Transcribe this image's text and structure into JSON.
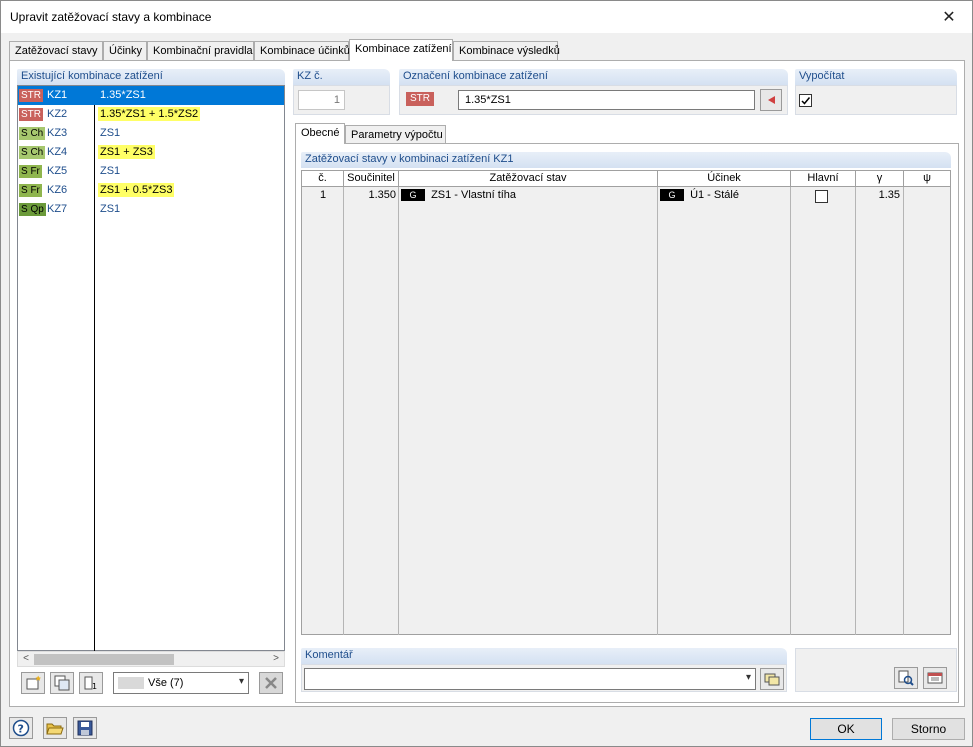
{
  "window": {
    "title": "Upravit zatěžovací stavy a kombinace"
  },
  "tabs": [
    {
      "label": "Zatěžovací stavy"
    },
    {
      "label": "Účinky"
    },
    {
      "label": "Kombinační pravidla"
    },
    {
      "label": "Kombinace účinků"
    },
    {
      "label": "Kombinace zatížení",
      "active": true
    },
    {
      "label": "Kombinace výsledků"
    }
  ],
  "left": {
    "header": "Existující kombinace zatížení",
    "rows": [
      {
        "badge": "STR",
        "kz": "KZ1",
        "formula": "1.35*ZS1",
        "selected": true,
        "highlight": true
      },
      {
        "badge": "STR",
        "kz": "KZ2",
        "formula": "1.35*ZS1 + 1.5*ZS2",
        "highlight": true
      },
      {
        "badge": "S Ch",
        "kz": "KZ3",
        "formula": "ZS1"
      },
      {
        "badge": "S Ch",
        "kz": "KZ4",
        "formula": "ZS1 + ZS3",
        "highlight": true
      },
      {
        "badge": "S Fr",
        "kz": "KZ5",
        "formula": "ZS1"
      },
      {
        "badge": "S Fr",
        "kz": "KZ6",
        "formula": "ZS1 + 0.5*ZS3",
        "highlight": true
      },
      {
        "badge": "S Qp",
        "kz": "KZ7",
        "formula": "ZS1"
      }
    ],
    "filter_value": "Vše (7)"
  },
  "kz_no": {
    "header": "KZ č.",
    "value": "1"
  },
  "designation": {
    "header": "Označení kombinace zatížení",
    "badge": "STR",
    "value": "1.35*ZS1"
  },
  "calculate": {
    "header": "Vypočítat",
    "checked": true
  },
  "subtabs": [
    {
      "label": "Obecné",
      "active": true
    },
    {
      "label": "Parametry výpočtu"
    }
  ],
  "loadcases": {
    "header": "Zatěžovací stavy v kombinaci zatížení KZ1",
    "columns": [
      "č.",
      "Součinitel",
      "Zatěžovací stav",
      "Účinek",
      "Hlavní",
      "γ",
      "ψ"
    ],
    "rows": [
      {
        "no": "1",
        "factor": "1.350",
        "lc_badge": "G",
        "lc": "ZS1 - Vlastní tíha",
        "action_badge": "G",
        "action": "Ú1 - Stálé",
        "main": false,
        "gamma": "1.35",
        "psi": ""
      }
    ]
  },
  "comment": {
    "header": "Komentář",
    "value": ""
  },
  "buttons": {
    "ok": "OK",
    "cancel": "Storno"
  }
}
